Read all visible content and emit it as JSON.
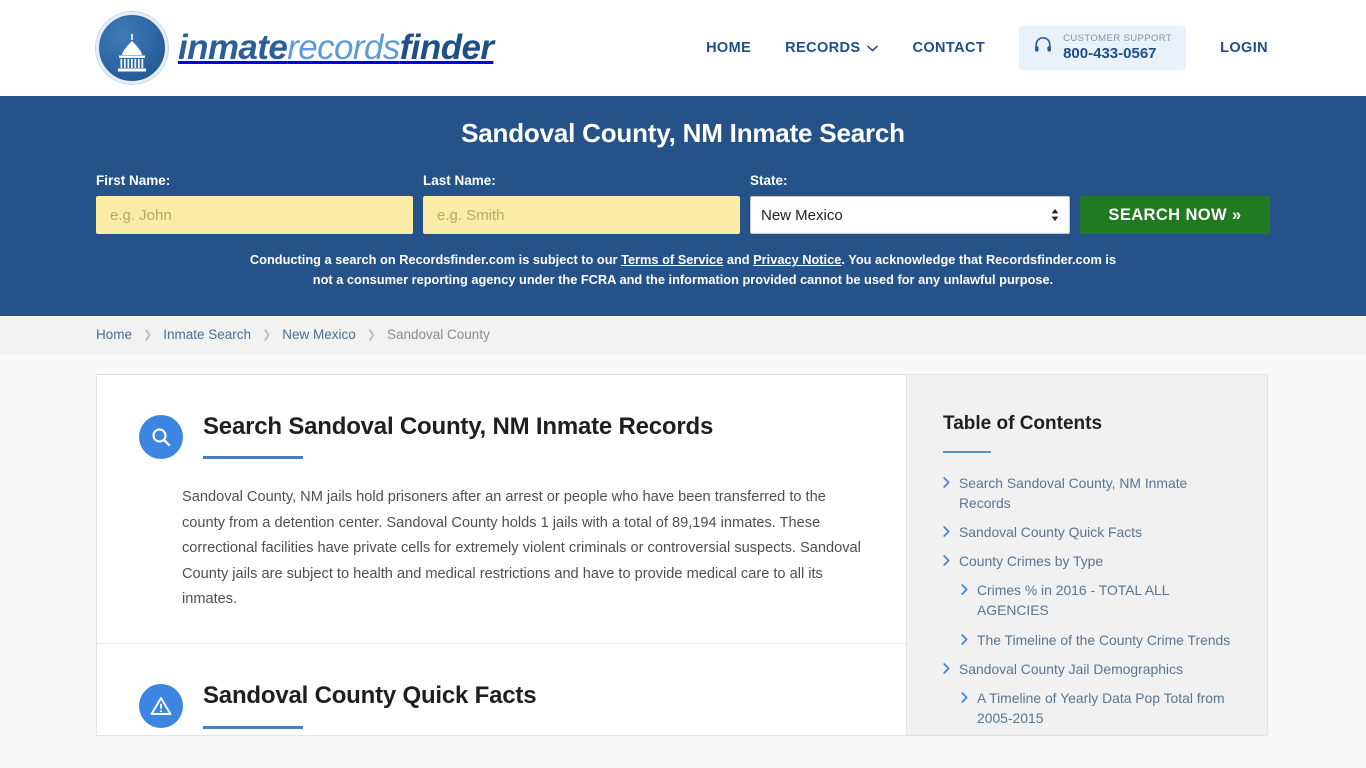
{
  "header": {
    "logo": {
      "icon": "capitol-dome-icon",
      "part1": "inmate",
      "part2": "records",
      "part3": "finder"
    },
    "nav": [
      {
        "label": "HOME",
        "has_caret": false
      },
      {
        "label": "RECORDS",
        "has_caret": true
      },
      {
        "label": "CONTACT",
        "has_caret": false
      }
    ],
    "support": {
      "icon": "headset-icon",
      "label": "CUSTOMER SUPPORT",
      "phone": "800-433-0567"
    },
    "login_label": "LOGIN"
  },
  "hero": {
    "title": "Sandoval County, NM Inmate Search",
    "first_name": {
      "label": "First Name:",
      "value": "",
      "placeholder": "e.g. John"
    },
    "last_name": {
      "label": "Last Name:",
      "value": "",
      "placeholder": "e.g. Smith"
    },
    "state": {
      "label": "State:",
      "value": "New Mexico",
      "options": [
        "New Mexico"
      ]
    },
    "search_button": "SEARCH NOW »",
    "disclaimer": {
      "part1": "Conducting a search on Recordsfinder.com is subject to our ",
      "link1": "Terms of Service",
      "part2": " and ",
      "link2": "Privacy Notice",
      "part3": ". You acknowledge that Recordsfinder.com is not a consumer reporting agency under the FCRA and the information provided cannot be used for any unlawful purpose."
    }
  },
  "breadcrumb": {
    "items": [
      {
        "label": "Home",
        "current": false
      },
      {
        "label": "Inmate Search",
        "current": false
      },
      {
        "label": "New Mexico",
        "current": false
      },
      {
        "label": "Sandoval County",
        "current": true
      }
    ],
    "separator": "❯"
  },
  "main": {
    "sections": [
      {
        "icon": "magnifier-icon",
        "title": "Search Sandoval County, NM Inmate Records",
        "body": "Sandoval County, NM jails hold prisoners after an arrest or people who have been transferred to the county from a detention center. Sandoval County holds 1 jails with a total of 89,194 inmates. These correctional facilities have private cells for extremely violent criminals or controversial suspects. Sandoval County jails are subject to health and medical restrictions and have to provide medical care to all its inmates."
      },
      {
        "icon": "warning-triangle-icon",
        "title": "Sandoval County Quick Facts",
        "body": ""
      }
    ]
  },
  "sidebar": {
    "title": "Table of Contents",
    "items": [
      {
        "label": "Search Sandoval County, NM Inmate Records",
        "sub": false
      },
      {
        "label": "Sandoval County Quick Facts",
        "sub": false
      },
      {
        "label": "County Crimes by Type",
        "sub": false
      },
      {
        "label": "Crimes % in 2016 - TOTAL ALL AGENCIES",
        "sub": true
      },
      {
        "label": "The Timeline of the County Crime Trends",
        "sub": true
      },
      {
        "label": "Sandoval County Jail Demographics",
        "sub": false
      },
      {
        "label": "A Timeline of Yearly Data Pop Total from 2005-2015",
        "sub": true
      }
    ]
  },
  "colors": {
    "hero_blue": "#255289",
    "brand_blue": "#1d4f88",
    "accent_blue": "#3c86e2",
    "search_green": "#1f7a21",
    "input_yellow": "#faeca4"
  }
}
